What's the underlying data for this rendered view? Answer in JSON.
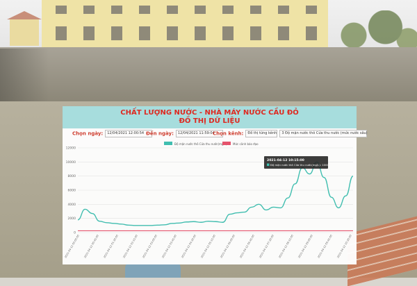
{
  "header": {
    "title": "CHẤT LƯỢNG NƯỚC - NHÀ MÁY NƯỚC CẦU ĐỎ",
    "subtitle": "ĐỒ THỊ DỮ LIỆU"
  },
  "filters": {
    "from_label": "Chọn ngày:",
    "from_value": "12/04/2021 12:00:54",
    "to_label": "Đến ngày:",
    "to_value": "12/04/2021 11:59:04",
    "channel_label": "Chọn kênh:",
    "channel_type": "Đồ thị từng kênh",
    "channel_value": "3 Độ mặn nước thô Cửa thu nước (mức nước sâu)"
  },
  "tooltip": {
    "time": "2021-04-12 10:15:00",
    "text": "Độ mặn nước thô Cửa thu nước(mg/L): 10000"
  },
  "colors": {
    "series": "#3cbfb1",
    "alarm": "#e8506b",
    "title": "#e0241b",
    "header_bg": "#a7dfe0"
  },
  "chart_data": {
    "type": "line",
    "legend": [
      "Độ mặn nước thô Cửa thu nước(mg/L)",
      "Mức cảnh báo đạo"
    ],
    "legend_position": "top-center",
    "ylim": [
      0,
      12000
    ],
    "yticks": [
      "0",
      "2000",
      "4000",
      "6000",
      "8000",
      "10000",
      "12000"
    ],
    "xticks": [
      "2021-04-12 00:00:00",
      "2021-04-12 00:45:00",
      "2021-04-12 01:30:00",
      "2021-04-12 02:15:00",
      "2021-04-12 03:00:00",
      "2021-04-12 03:45:00",
      "2021-04-12 04:30:00",
      "2021-04-12 05:15:00",
      "2021-04-12 06:00:00",
      "2021-04-12 06:45:00",
      "2021-04-12 07:30:00",
      "2021-04-12 08:15:00",
      "2021-04-12 09:00:00",
      "2021-04-12 09:45:00",
      "2021-04-12 10:30:00"
    ],
    "series": [
      {
        "name": "Độ mặn nước thô Cửa thu nước(mg/L)",
        "values": [
          1800,
          3300,
          2700,
          1600,
          1400,
          1300,
          1200,
          1050,
          1000,
          1000,
          1000,
          1050,
          1100,
          1300,
          1350,
          1500,
          1550,
          1450,
          1600,
          1550,
          1450,
          2600,
          2800,
          2900,
          3600,
          4000,
          3200,
          3600,
          3500,
          4900,
          6900,
          9200,
          8300,
          10000,
          7800,
          5000,
          3500,
          5200,
          8000
        ]
      },
      {
        "name": "Mức cảnh báo đạo",
        "values": [
          250,
          250
        ]
      }
    ],
    "grid": true
  }
}
